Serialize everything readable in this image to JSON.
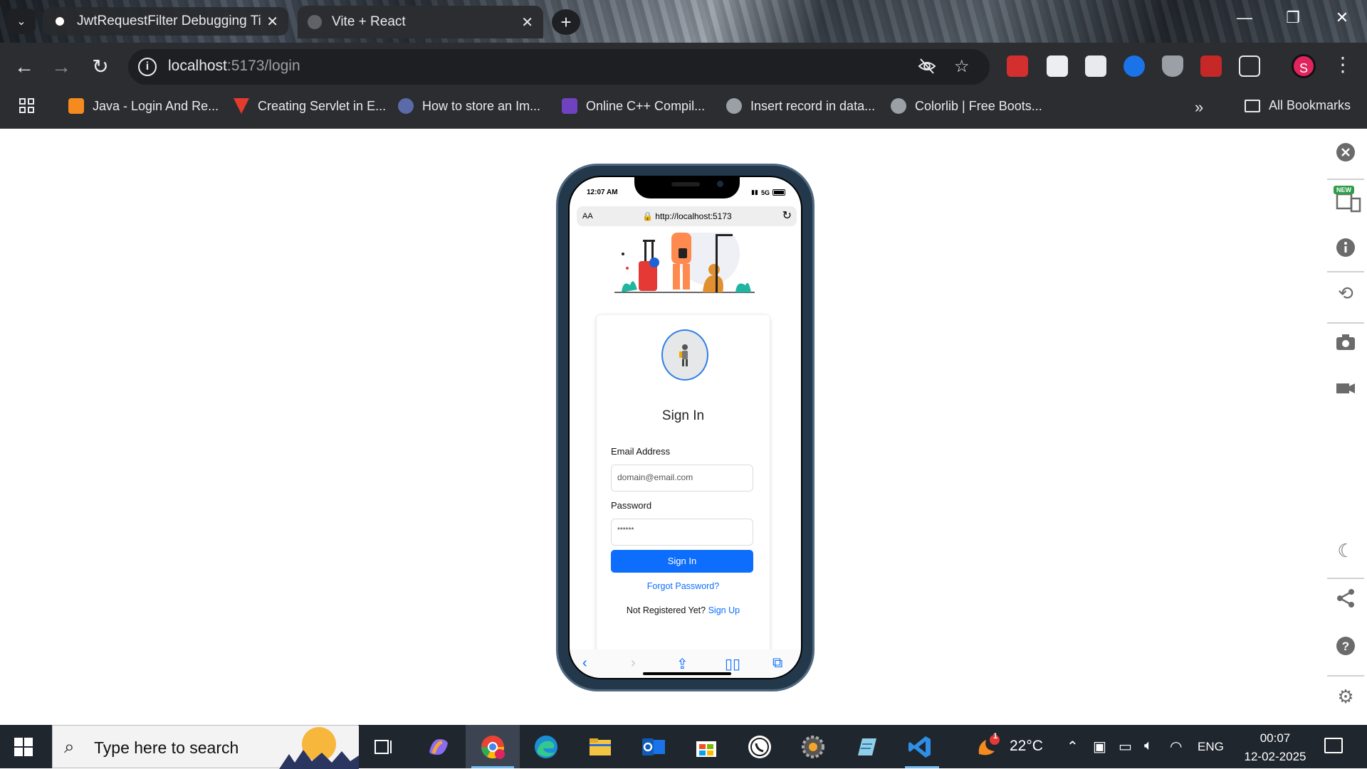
{
  "browser": {
    "tabs": [
      {
        "title": "JwtRequestFilter Debugging Tip",
        "active": false
      },
      {
        "title": "Vite + React",
        "active": true
      }
    ],
    "new_tab_label": "+",
    "window_controls": {
      "minimize": "—",
      "restore": "❐",
      "close": "✕"
    },
    "address": {
      "host": "localhost",
      "path": ":5173/login"
    },
    "bookmarks": [
      {
        "label": "Java - Login And Re...",
        "color": "#f58a1f"
      },
      {
        "label": "Creating Servlet in E...",
        "color": "#e33b2e"
      },
      {
        "label": "How to store an Im...",
        "color": "#5b6aa8"
      },
      {
        "label": "Online C++ Compil...",
        "color": "#6f42c1"
      },
      {
        "label": "Insert record in data...",
        "color": "#9aa0a6"
      },
      {
        "label": "Colorlib | Free Boots...",
        "color": "#9aa0a6"
      }
    ],
    "bookmarks_overflow": "»",
    "all_bookmarks": "All Bookmarks",
    "profile_initial": "S"
  },
  "device": {
    "status_time": "12:07 AM",
    "network": "5G",
    "safari_aa": "AA",
    "safari_url": "http://localhost:5173"
  },
  "login": {
    "title": "Sign In",
    "email_label": "Email Address",
    "email_placeholder": "domain@email.com",
    "password_label": "Password",
    "password_value": "******",
    "submit_label": "Sign In",
    "forgot_label": "Forgot Password?",
    "register_prompt": "Not Registered Yet?",
    "register_link": "Sign Up"
  },
  "devtools_rail": {
    "badge": "NEW",
    "items": [
      "close-icon",
      "responsive-icon",
      "info-icon",
      "rotate-icon",
      "camera-icon",
      "video-icon",
      "moon-icon",
      "share-icon",
      "help-icon",
      "settings-icon"
    ]
  },
  "taskbar": {
    "search_placeholder": "Type here to search",
    "weather_temp": "22°C",
    "weather_badge": "1",
    "language": "ENG",
    "time": "00:07",
    "date": "12-02-2025"
  },
  "colors": {
    "accent_blue": "#0d6efd",
    "chrome_dark": "#2b2d31",
    "taskbar": "#20262e"
  }
}
